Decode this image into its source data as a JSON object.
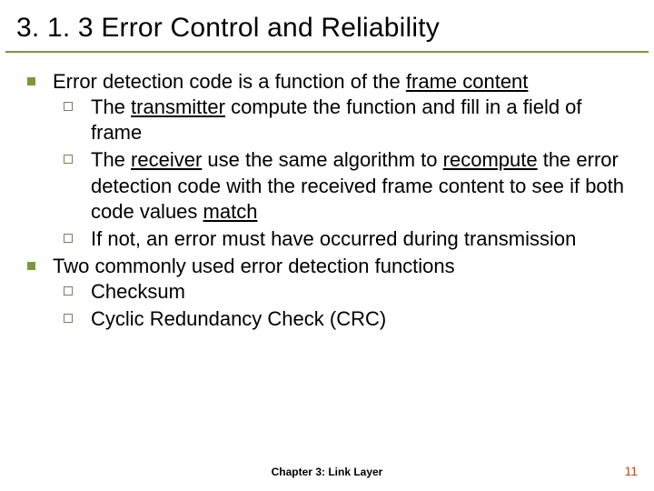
{
  "title": "3. 1. 3 Error Control and Reliability",
  "points": {
    "p1": {
      "pre": "Error detection code is a function of the ",
      "u1": "frame content",
      "sub1": {
        "a": "The ",
        "u": "transmitter",
        "b": " compute the function and fill in a field of frame"
      },
      "sub2": {
        "a": "The ",
        "u1": "receiver",
        "b": " use the same algorithm to ",
        "u2": "recompute",
        "c": " the error detection code with the received frame content to see if both code values ",
        "u3": "match"
      },
      "sub3": "If not, an error must have occurred during transmission"
    },
    "p2": {
      "text": "Two commonly used error detection functions",
      "sub1": "Checksum",
      "sub2": "Cyclic Redundancy Check (CRC)"
    }
  },
  "footer": {
    "center": "Chapter 3: Link Layer",
    "pageNumber": "11"
  }
}
